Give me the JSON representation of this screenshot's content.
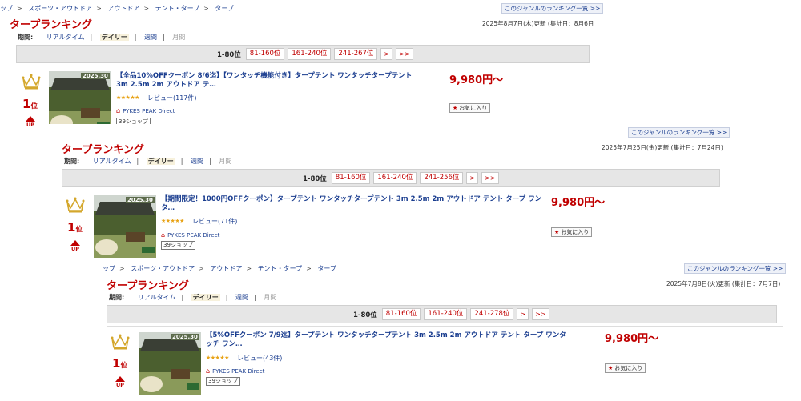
{
  "snapshots": [
    {
      "breadcrumb": [
        "ップ",
        "スポーツ・アウトドア",
        "アウトドア",
        "テント・タープ",
        "タープ"
      ],
      "more_link": "このジャンルのランキング一覧 >>",
      "title": "タープランキング",
      "updated": "2025年8月7日(木)更新 (集計日：8月6日",
      "period": {
        "label": "期間:",
        "realtime": "リアルタイム",
        "daily": "デイリー",
        "weekly": "週間",
        "monthly": "月間"
      },
      "pager": {
        "current": "1-80位",
        "pages": [
          "81-160位",
          "161-240位",
          "241-267位"
        ],
        "next": ">",
        "last": ">>"
      },
      "item": {
        "rank": "1",
        "rank_unit": "位",
        "trend": "UP",
        "thumb_year": "2025.30",
        "name": "【全品10%OFFクーポン 8/6迄】【ワンタッチ機能付き】タープテント ワンタッチタープテント 3m 2.5m 2m アウトドア テ…",
        "stars": "★★★★★",
        "review": "レビュー(117件)",
        "shop": "PYKES PEAK Direct",
        "badge": "39ショップ",
        "price": "9,980円〜",
        "fav": "お気に入り"
      }
    },
    {
      "breadcrumb": [],
      "more_link": "このジャンルのランキング一覧 >>",
      "title": "タープランキング",
      "updated": "2025年7月25日(金)更新 (集計日：7月24日)",
      "period": {
        "label": "期間:",
        "realtime": "リアルタイム",
        "daily": "デイリー",
        "weekly": "週間",
        "monthly": "月間"
      },
      "pager": {
        "current": "1-80位",
        "pages": [
          "81-160位",
          "161-240位",
          "241-256位"
        ],
        "next": ">",
        "last": ">>"
      },
      "item": {
        "rank": "1",
        "rank_unit": "位",
        "trend": "UP",
        "thumb_year": "2025.30",
        "name": "【期間限定！1000円OFFクーポン】タープテント ワンタッチタープテント 3m 2.5m 2m アウトドア テント タープ ワンタ…",
        "stars": "★★★★★",
        "review": "レビュー(71件)",
        "shop": "PYKES PEAK Direct",
        "badge": "39ショップ",
        "price": "9,980円〜",
        "fav": "お気に入り"
      }
    },
    {
      "breadcrumb": [
        "ップ",
        "スポーツ・アウトドア",
        "アウトドア",
        "テント・タープ",
        "タープ"
      ],
      "more_link": "このジャンルのランキング一覧 >>",
      "title": "タープランキング",
      "updated": "2025年7月8日(火)更新 (集計日：7月7日)",
      "period": {
        "label": "期間:",
        "realtime": "リアルタイム",
        "daily": "デイリー",
        "weekly": "週間",
        "monthly": "月間"
      },
      "pager": {
        "current": "1-80位",
        "pages": [
          "81-160位",
          "161-240位",
          "241-278位"
        ],
        "next": ">",
        "last": ">>"
      },
      "item": {
        "rank": "1",
        "rank_unit": "位",
        "trend": "UP",
        "thumb_year": "2025.30",
        "name": "【5%OFFクーポン 7/9迄】タープテント ワンタッチタープテント 3m 2.5m 2m アウトドア テント タープ ワンタッチ ワン…",
        "stars": "★★★★★",
        "review": "レビュー(43件)",
        "shop": "PYKES PEAK Direct",
        "badge": "39ショップ",
        "price": "9,980円〜",
        "fav": "お気に入り"
      }
    }
  ],
  "colors": {
    "title_red": "#c00000",
    "link_blue": "#1a3d8f",
    "pager_bg": "#e6e6e6",
    "star": "#e8a317"
  }
}
